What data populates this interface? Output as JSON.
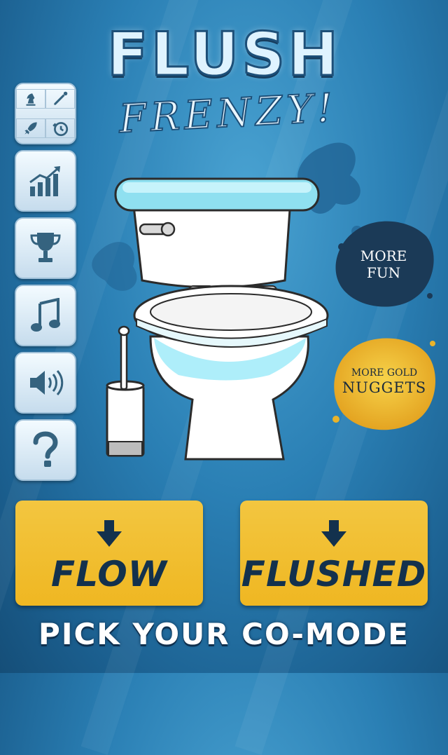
{
  "title": {
    "line1": "FLUSH",
    "line2": "FRENZY!"
  },
  "sidebar": {
    "mode_icons": [
      "chess-knight-icon",
      "bat-ball-icon",
      "rocket-icon",
      "timer-icon"
    ],
    "buttons": [
      "stats-chart-icon",
      "trophy-icon",
      "music-note-icon",
      "speaker-icon",
      "question-mark-icon"
    ]
  },
  "promo": {
    "more_fun": {
      "line1": "MORE",
      "line2": "FUN",
      "color": "#1b3a57"
    },
    "more_gold": {
      "line1": "MORE GOLD",
      "line2": "NUGGETS",
      "color": "#f2c02a"
    }
  },
  "modes": [
    {
      "label": "FLOW"
    },
    {
      "label": "FLUSHED"
    }
  ],
  "footer": "PICK YOUR CO-MODE",
  "colors": {
    "button_yellow": "#f0bd2e",
    "text_navy": "#13314d",
    "bg_blue": "#2a7fb4"
  }
}
